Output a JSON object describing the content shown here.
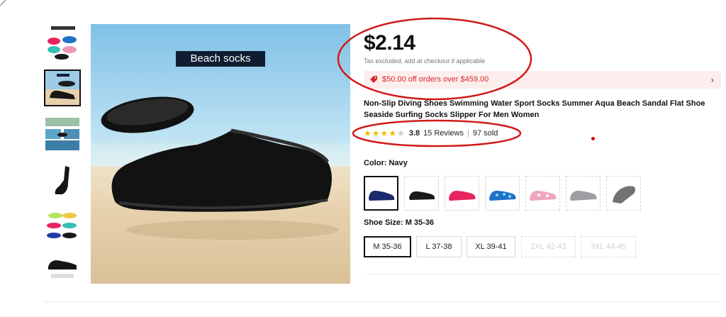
{
  "main_image": {
    "banner_text": "Beach socks"
  },
  "thumbnails": [
    {
      "name": "thumb-1",
      "active": false
    },
    {
      "name": "thumb-2",
      "active": true
    },
    {
      "name": "thumb-3",
      "active": false
    },
    {
      "name": "thumb-4",
      "active": false
    },
    {
      "name": "thumb-5",
      "active": false
    },
    {
      "name": "thumb-6",
      "active": false
    }
  ],
  "product": {
    "price": "$2.14",
    "tax_note": "Tax excluded, add at checkout if applicable",
    "coupon_text": "$50.00 off orders over $459.00",
    "title": "Non-Slip Diving Shoes Swimming Water Sport Socks Summer Aqua Beach Sandal Flat Shoe Seaside Surfing Socks Slipper For Men Women",
    "rating": "3.8",
    "rating_stars": 4,
    "reviews": "15 Reviews",
    "sold": "97 sold"
  },
  "color": {
    "label": "Color:",
    "selected": "Navy",
    "swatches": [
      {
        "name": "navy",
        "fill": "#1c2a6e",
        "disabled": false,
        "selected": true
      },
      {
        "name": "black",
        "fill": "#1b1b1b",
        "disabled": false,
        "selected": false
      },
      {
        "name": "rose-red",
        "fill": "#e8245f",
        "disabled": false,
        "selected": false
      },
      {
        "name": "blue-pattern",
        "fill": "#1f72c9",
        "disabled": false,
        "selected": false
      },
      {
        "name": "pink-pattern",
        "fill": "#ec97b4",
        "disabled": true,
        "selected": false
      },
      {
        "name": "gray",
        "fill": "#8c8f95",
        "disabled": true,
        "selected": false
      },
      {
        "name": "dark-gray",
        "fill": "#5a5a5a",
        "disabled": true,
        "selected": false
      }
    ]
  },
  "size": {
    "label": "Shoe Size:",
    "selected": "M 35-36",
    "options": [
      {
        "label": "M 35-36",
        "selected": true,
        "disabled": false
      },
      {
        "label": "L 37-38",
        "selected": false,
        "disabled": false
      },
      {
        "label": "XL 39-41",
        "selected": false,
        "disabled": false
      },
      {
        "label": "2XL 42-43",
        "selected": false,
        "disabled": true
      },
      {
        "label": "3XL 44-45",
        "selected": false,
        "disabled": true
      }
    ]
  },
  "colors": {
    "accent_red": "#d9282b",
    "coupon_bg": "#fdeeee",
    "star": "#f5b800",
    "annotation": "#d11a1a"
  }
}
